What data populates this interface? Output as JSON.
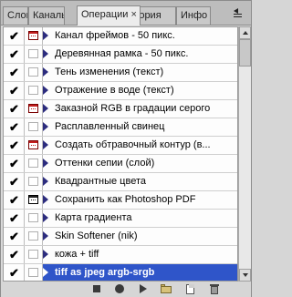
{
  "tabs": [
    {
      "label": "Слои",
      "active": false
    },
    {
      "label": "Каналы",
      "active": false
    },
    {
      "label": "Операции",
      "active": true
    },
    {
      "label": "История",
      "active": false
    },
    {
      "label": "Инфо",
      "active": false
    }
  ],
  "tab_close": "×",
  "check_glyph": "✔",
  "actions": [
    {
      "label": "Канал фреймов - 50 пикс.",
      "checked": true,
      "dialog": "red",
      "selected": false
    },
    {
      "label": "Деревянная рамка - 50 пикс.",
      "checked": true,
      "dialog": "empty",
      "selected": false
    },
    {
      "label": "Тень изменения (текст)",
      "checked": true,
      "dialog": "empty",
      "selected": false
    },
    {
      "label": "Отражение в воде (текст)",
      "checked": true,
      "dialog": "empty",
      "selected": false
    },
    {
      "label": "Заказной RGB в градации серого",
      "checked": true,
      "dialog": "red",
      "selected": false
    },
    {
      "label": "Расплавленный свинец",
      "checked": true,
      "dialog": "empty",
      "selected": false
    },
    {
      "label": "Создать обтравочный контур (в...",
      "checked": true,
      "dialog": "red",
      "selected": false
    },
    {
      "label": "Оттенки сепии (слой)",
      "checked": true,
      "dialog": "empty",
      "selected": false
    },
    {
      "label": "Квадрантные цвета",
      "checked": true,
      "dialog": "empty",
      "selected": false
    },
    {
      "label": "Сохранить как Photoshop PDF",
      "checked": true,
      "dialog": "dark",
      "selected": false
    },
    {
      "label": "Карта градиента",
      "checked": true,
      "dialog": "empty",
      "selected": false
    },
    {
      "label": "Skin Softener (nik)",
      "checked": true,
      "dialog": "empty",
      "selected": false
    },
    {
      "label": "кожа + tiff",
      "checked": true,
      "dialog": "empty",
      "selected": false
    },
    {
      "label": "tiff as jpeg argb-srgb",
      "checked": true,
      "dialog": "empty",
      "selected": true
    }
  ],
  "toolbar": [
    "stop",
    "record",
    "play",
    "new-set",
    "new-action",
    "delete"
  ]
}
